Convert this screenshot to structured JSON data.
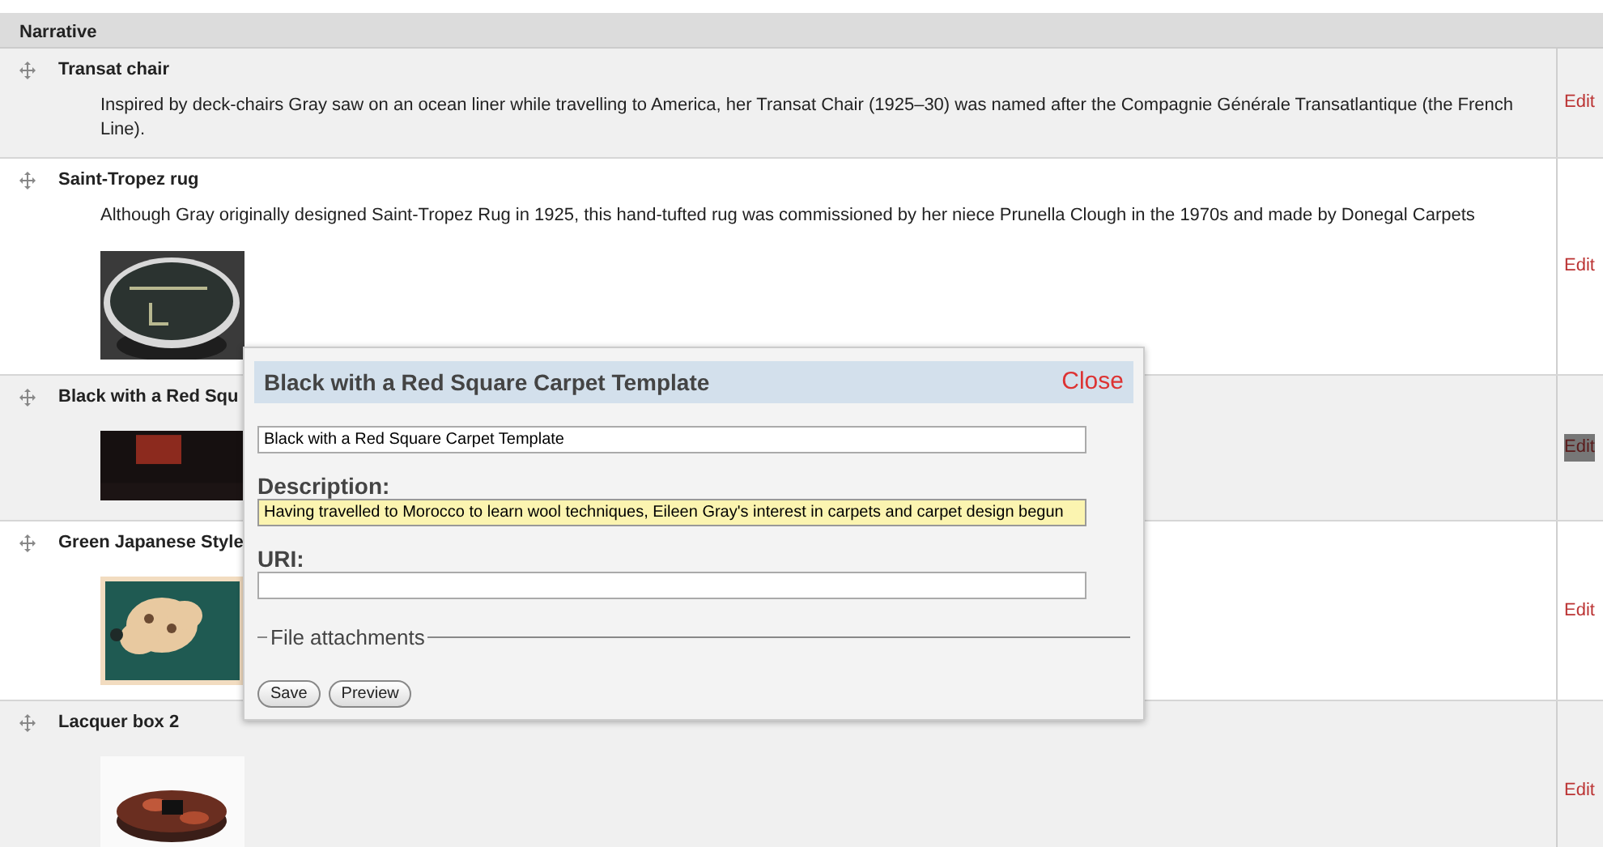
{
  "table": {
    "columns": [
      "Narrative"
    ],
    "rows": [
      {
        "title": "Transat chair",
        "description": "Inspired by deck-chairs Gray saw on an ocean liner while travelling to America, her Transat Chair (1925–30) was named after the Compagnie Générale Transatlantique (the French Line).",
        "edit": {
          "label": "Edit",
          "selected": false
        }
      },
      {
        "title": "Saint-Tropez rug",
        "description": "Although Gray originally designed Saint-Tropez Rug in 1925, this hand-tufted rug was commissioned by her niece Prunella Clough in the 1970s and made by Donegal Carpets",
        "edit": {
          "label": "Edit",
          "selected": false
        }
      },
      {
        "title": "Black with a Red Squ",
        "edit": {
          "label": "Edit",
          "selected": true
        }
      },
      {
        "title": "Green Japanese Style",
        "edit": {
          "label": "Edit",
          "selected": false
        }
      },
      {
        "title": "Lacquer box 2",
        "edit": {
          "label": "Edit",
          "selected": false
        }
      }
    ]
  },
  "dialog": {
    "title": "Black with a Red Square Carpet Template",
    "close": "Close",
    "fields": [
      {
        "kind": "text",
        "value": "Black with a Red Square Carpet Template"
      },
      {
        "kind": "text",
        "label": "Description:",
        "value": "Having travelled to Morocco to learn wool techniques, Eileen Gray's interest in carpets and carpet design begun",
        "focused": true
      },
      {
        "kind": "text",
        "label": "URI:"
      }
    ],
    "fieldset": "File attachments",
    "buttons": [
      "Save",
      "Preview"
    ]
  }
}
